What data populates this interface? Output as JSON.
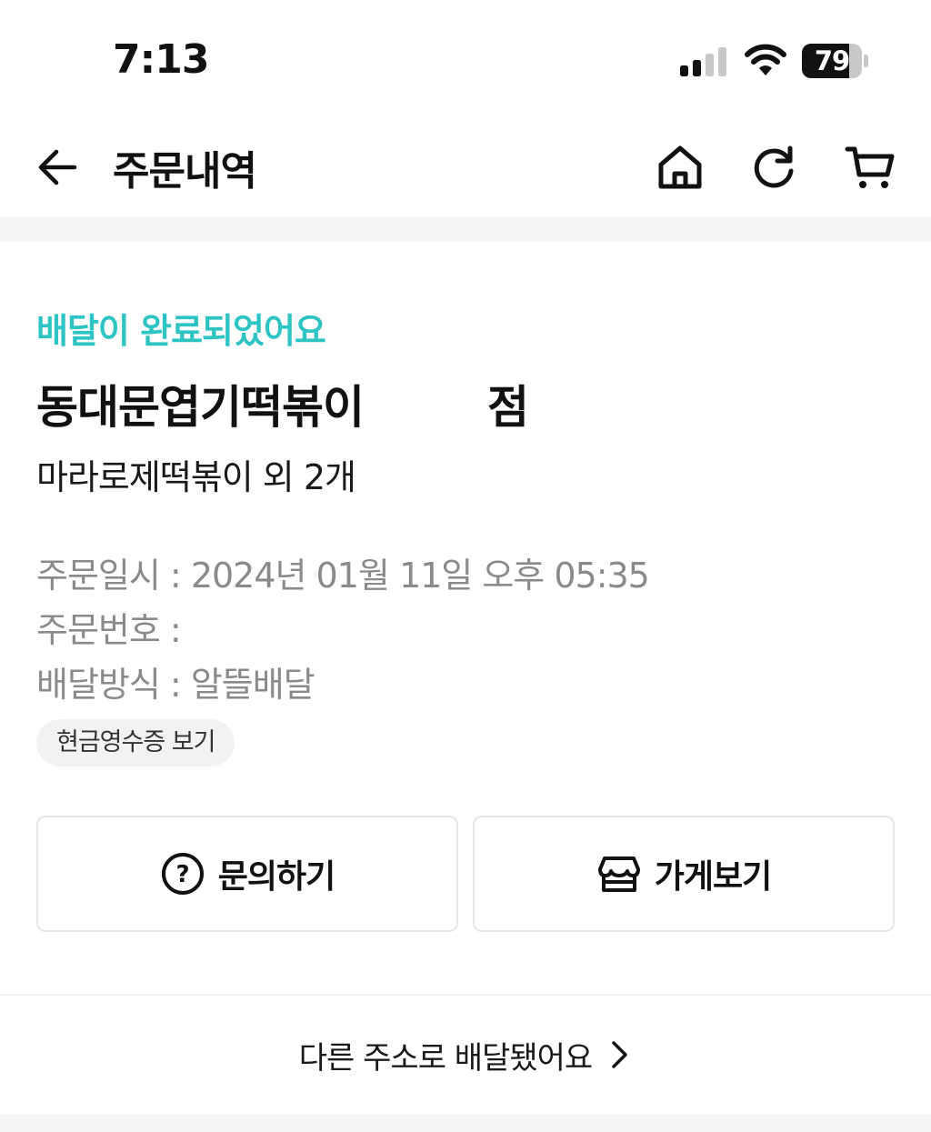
{
  "status_bar": {
    "time": "7:13",
    "battery_level": "79",
    "battery_fraction": 0.79
  },
  "header": {
    "title": "주문내역",
    "icons": [
      "back-arrow-icon",
      "home-icon",
      "refresh-icon",
      "cart-icon"
    ]
  },
  "order": {
    "status": "배달이 완료되었어요",
    "store_name": "동대문엽기떡볶이",
    "store_suffix": "점",
    "menu_summary": "마라로제떡볶이 외 2개",
    "info": [
      {
        "label": "주문일시 : ",
        "value": "2024년 01월 11일 오후 05:35"
      },
      {
        "label": "주문번호 : ",
        "value": ""
      },
      {
        "label": "배달방식 : ",
        "value": "알뜰배달"
      }
    ],
    "receipt_button": "현금영수증 보기"
  },
  "actions": {
    "inquiry_label": "문의하기",
    "store_label": "가게보기"
  },
  "address_link": {
    "label": "다른 주소로 배달됐어요"
  },
  "colors": {
    "accent": "#2ec4c4",
    "muted_text": "#8a8a8a",
    "band": "#f4f5f7"
  }
}
